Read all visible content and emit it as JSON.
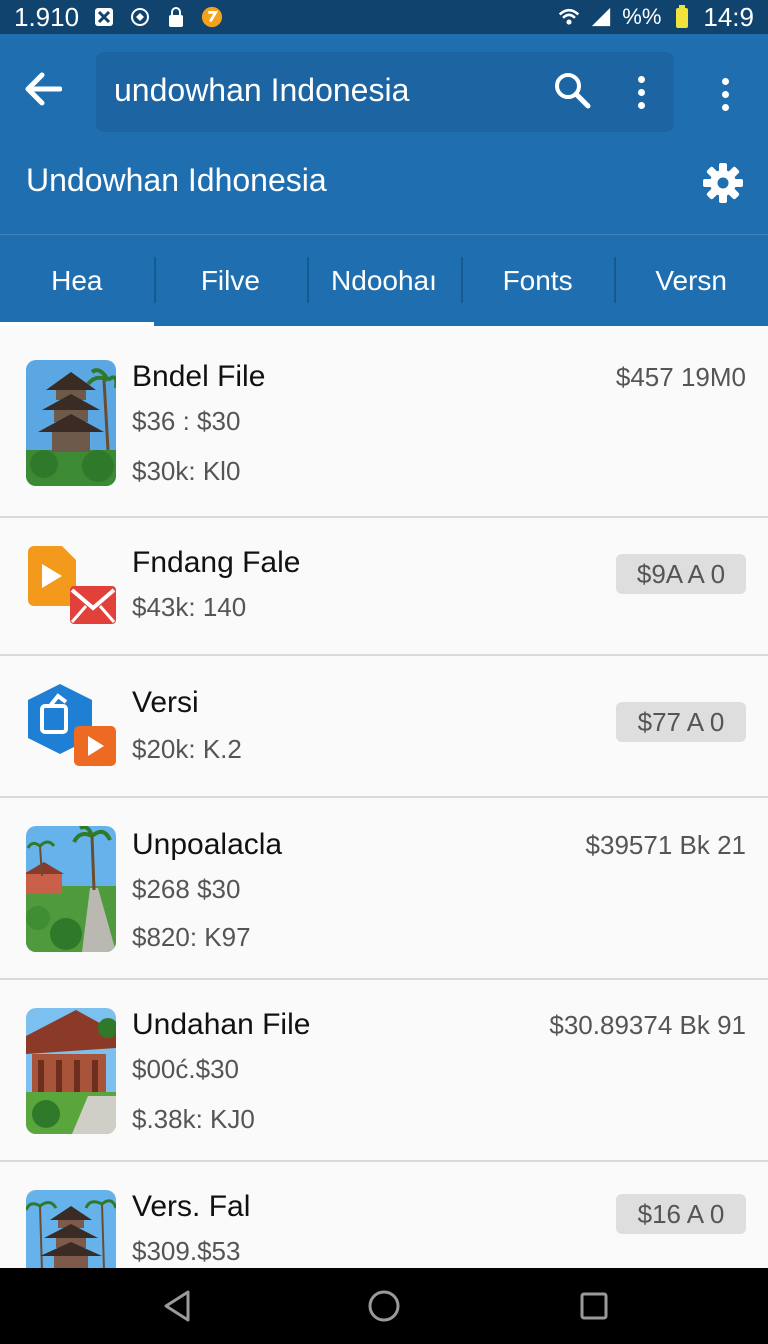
{
  "status_bar": {
    "time_left": "1.910",
    "battery": "%%",
    "time_right": "14:9"
  },
  "search": {
    "query": "undowhan Indonesia"
  },
  "appbar": {
    "title": "Undowhan Idhonesia"
  },
  "tabs": [
    {
      "label": "Hea",
      "active": true
    },
    {
      "label": "Filve",
      "active": false
    },
    {
      "label": "Ndoohaı",
      "active": false
    },
    {
      "label": "Fonts",
      "active": false
    },
    {
      "label": "Versn",
      "active": false
    }
  ],
  "list": [
    {
      "title": "Bndel File",
      "line1": "$36 : $30",
      "line2": "$30k: Kl0",
      "right": "$457 19M0",
      "right_style": "text"
    },
    {
      "title": "Fndang Fale",
      "line1": "$43k: 140",
      "right": "$9A A 0",
      "right_style": "chip"
    },
    {
      "title": "Versi",
      "line1": "$20k: K.2",
      "right": "$77 A 0",
      "right_style": "chip"
    },
    {
      "title": "Unpoalacla",
      "line1": "$268 $30",
      "line2": "$820: K97",
      "right": "$39571 Bk 21",
      "right_style": "text"
    },
    {
      "title": "Undahan File",
      "line1": "$00ć.$30",
      "line2": "$.38k: KJ0",
      "right": "$30.89374 Bk 91",
      "right_style": "text"
    },
    {
      "title": "Vers. Fal",
      "line1": "$309.$53",
      "right": "$16 A 0",
      "right_style": "chip"
    }
  ],
  "colors": {
    "status_bar": "#10436e",
    "app_bar": "#1f6fb0",
    "search_box": "#1c64a2",
    "list_bg": "#fafafa",
    "chip_bg": "#dedede"
  },
  "icons": {
    "back": "arrow-left-icon",
    "search": "search-icon",
    "menu": "kebab-menu-icon",
    "settings": "gear-icon",
    "nav": [
      "back-triangle-icon",
      "home-circle-icon",
      "recents-square-icon"
    ]
  }
}
